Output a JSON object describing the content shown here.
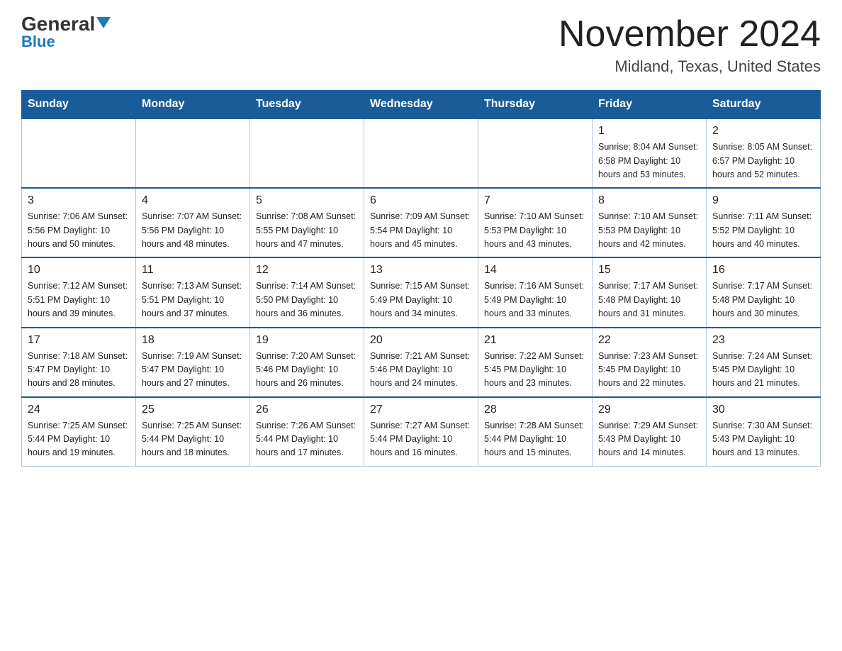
{
  "header": {
    "logo_general": "General",
    "logo_blue": "Blue",
    "title": "November 2024",
    "subtitle": "Midland, Texas, United States"
  },
  "calendar": {
    "days_of_week": [
      "Sunday",
      "Monday",
      "Tuesday",
      "Wednesday",
      "Thursday",
      "Friday",
      "Saturday"
    ],
    "weeks": [
      [
        {
          "day": "",
          "info": ""
        },
        {
          "day": "",
          "info": ""
        },
        {
          "day": "",
          "info": ""
        },
        {
          "day": "",
          "info": ""
        },
        {
          "day": "",
          "info": ""
        },
        {
          "day": "1",
          "info": "Sunrise: 8:04 AM\nSunset: 6:58 PM\nDaylight: 10 hours and 53 minutes."
        },
        {
          "day": "2",
          "info": "Sunrise: 8:05 AM\nSunset: 6:57 PM\nDaylight: 10 hours and 52 minutes."
        }
      ],
      [
        {
          "day": "3",
          "info": "Sunrise: 7:06 AM\nSunset: 5:56 PM\nDaylight: 10 hours and 50 minutes."
        },
        {
          "day": "4",
          "info": "Sunrise: 7:07 AM\nSunset: 5:56 PM\nDaylight: 10 hours and 48 minutes."
        },
        {
          "day": "5",
          "info": "Sunrise: 7:08 AM\nSunset: 5:55 PM\nDaylight: 10 hours and 47 minutes."
        },
        {
          "day": "6",
          "info": "Sunrise: 7:09 AM\nSunset: 5:54 PM\nDaylight: 10 hours and 45 minutes."
        },
        {
          "day": "7",
          "info": "Sunrise: 7:10 AM\nSunset: 5:53 PM\nDaylight: 10 hours and 43 minutes."
        },
        {
          "day": "8",
          "info": "Sunrise: 7:10 AM\nSunset: 5:53 PM\nDaylight: 10 hours and 42 minutes."
        },
        {
          "day": "9",
          "info": "Sunrise: 7:11 AM\nSunset: 5:52 PM\nDaylight: 10 hours and 40 minutes."
        }
      ],
      [
        {
          "day": "10",
          "info": "Sunrise: 7:12 AM\nSunset: 5:51 PM\nDaylight: 10 hours and 39 minutes."
        },
        {
          "day": "11",
          "info": "Sunrise: 7:13 AM\nSunset: 5:51 PM\nDaylight: 10 hours and 37 minutes."
        },
        {
          "day": "12",
          "info": "Sunrise: 7:14 AM\nSunset: 5:50 PM\nDaylight: 10 hours and 36 minutes."
        },
        {
          "day": "13",
          "info": "Sunrise: 7:15 AM\nSunset: 5:49 PM\nDaylight: 10 hours and 34 minutes."
        },
        {
          "day": "14",
          "info": "Sunrise: 7:16 AM\nSunset: 5:49 PM\nDaylight: 10 hours and 33 minutes."
        },
        {
          "day": "15",
          "info": "Sunrise: 7:17 AM\nSunset: 5:48 PM\nDaylight: 10 hours and 31 minutes."
        },
        {
          "day": "16",
          "info": "Sunrise: 7:17 AM\nSunset: 5:48 PM\nDaylight: 10 hours and 30 minutes."
        }
      ],
      [
        {
          "day": "17",
          "info": "Sunrise: 7:18 AM\nSunset: 5:47 PM\nDaylight: 10 hours and 28 minutes."
        },
        {
          "day": "18",
          "info": "Sunrise: 7:19 AM\nSunset: 5:47 PM\nDaylight: 10 hours and 27 minutes."
        },
        {
          "day": "19",
          "info": "Sunrise: 7:20 AM\nSunset: 5:46 PM\nDaylight: 10 hours and 26 minutes."
        },
        {
          "day": "20",
          "info": "Sunrise: 7:21 AM\nSunset: 5:46 PM\nDaylight: 10 hours and 24 minutes."
        },
        {
          "day": "21",
          "info": "Sunrise: 7:22 AM\nSunset: 5:45 PM\nDaylight: 10 hours and 23 minutes."
        },
        {
          "day": "22",
          "info": "Sunrise: 7:23 AM\nSunset: 5:45 PM\nDaylight: 10 hours and 22 minutes."
        },
        {
          "day": "23",
          "info": "Sunrise: 7:24 AM\nSunset: 5:45 PM\nDaylight: 10 hours and 21 minutes."
        }
      ],
      [
        {
          "day": "24",
          "info": "Sunrise: 7:25 AM\nSunset: 5:44 PM\nDaylight: 10 hours and 19 minutes."
        },
        {
          "day": "25",
          "info": "Sunrise: 7:25 AM\nSunset: 5:44 PM\nDaylight: 10 hours and 18 minutes."
        },
        {
          "day": "26",
          "info": "Sunrise: 7:26 AM\nSunset: 5:44 PM\nDaylight: 10 hours and 17 minutes."
        },
        {
          "day": "27",
          "info": "Sunrise: 7:27 AM\nSunset: 5:44 PM\nDaylight: 10 hours and 16 minutes."
        },
        {
          "day": "28",
          "info": "Sunrise: 7:28 AM\nSunset: 5:44 PM\nDaylight: 10 hours and 15 minutes."
        },
        {
          "day": "29",
          "info": "Sunrise: 7:29 AM\nSunset: 5:43 PM\nDaylight: 10 hours and 14 minutes."
        },
        {
          "day": "30",
          "info": "Sunrise: 7:30 AM\nSunset: 5:43 PM\nDaylight: 10 hours and 13 minutes."
        }
      ]
    ]
  }
}
